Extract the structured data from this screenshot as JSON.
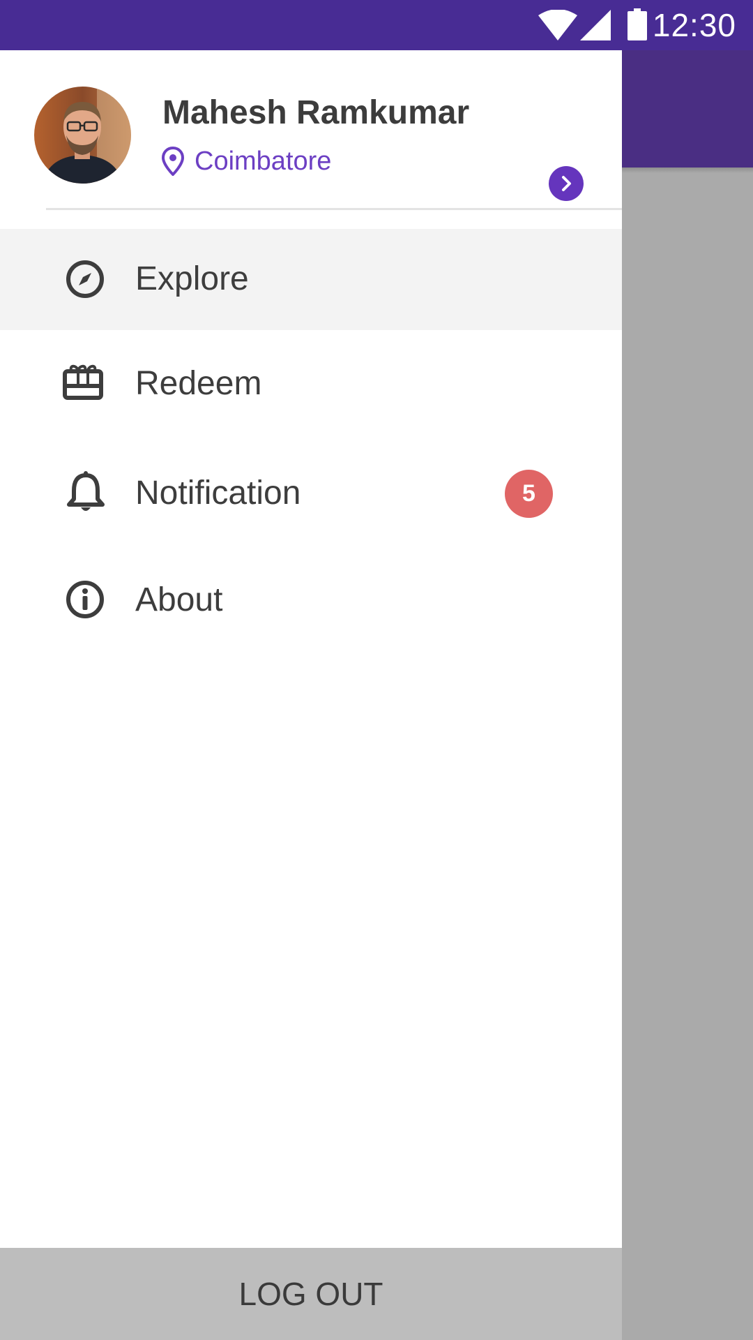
{
  "status_bar": {
    "time": "12:30",
    "icons": [
      "wifi-icon",
      "cell-signal-icon",
      "battery-icon"
    ],
    "background": "#482c94"
  },
  "drawer": {
    "profile": {
      "name": "Mahesh Ramkumar",
      "location": "Coimbatore",
      "location_icon": "map-pin-icon",
      "action_icon": "chevron-right-icon"
    },
    "menu": [
      {
        "label": "Explore",
        "icon": "compass-icon",
        "active": true
      },
      {
        "label": "Redeem",
        "icon": "gift-card-icon",
        "active": false
      },
      {
        "label": "Notification",
        "icon": "bell-icon",
        "active": false,
        "badge": "5"
      },
      {
        "label": "About",
        "icon": "info-icon",
        "active": false
      }
    ],
    "logout_label": "LOG OUT"
  },
  "colors": {
    "primary": "#482c94",
    "accent": "#6535bd",
    "location_text": "#6c3fc3",
    "badge": "#e06565",
    "active_item_bg": "#f3f3f3",
    "logout_bg": "#bdbdbd",
    "scrim": "#aaaaaa"
  }
}
